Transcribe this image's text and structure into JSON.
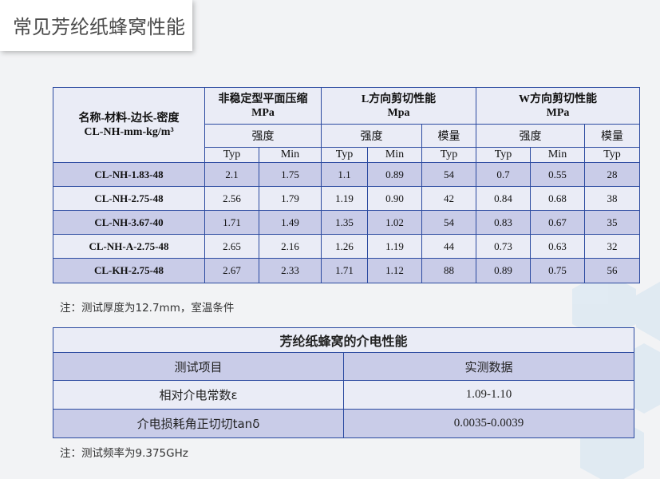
{
  "page_title": "常见芳纶纸蜂窝性能",
  "mech_table": {
    "name_header_line1": "名称-材料-边长-密度",
    "name_header_line2": "CL-NH-mm-kg/m³",
    "group1": {
      "line1": "非稳定型平面压缩",
      "line2": "MPa"
    },
    "group2": {
      "line1": "L方向剪切性能",
      "line2": "Mpa"
    },
    "group3": {
      "line1": "W方向剪切性能",
      "line2": "MPa"
    },
    "strength_label": "强度",
    "modulus_label": "模量",
    "typ_label": "Typ",
    "min_label": "Min",
    "rows": [
      {
        "name": "CL-NH-1.83-48",
        "values": [
          "2.1",
          "1.75",
          "1.1",
          "0.89",
          "54",
          "0.7",
          "0.55",
          "28"
        ]
      },
      {
        "name": "CL-NH-2.75-48",
        "values": [
          "2.56",
          "1.79",
          "1.19",
          "0.90",
          "42",
          "0.84",
          "0.68",
          "38"
        ]
      },
      {
        "name": "CL-NH-3.67-40",
        "values": [
          "1.71",
          "1.49",
          "1.35",
          "1.02",
          "54",
          "0.83",
          "0.67",
          "35"
        ]
      },
      {
        "name": "CL-NH-A-2.75-48",
        "values": [
          "2.65",
          "2.16",
          "1.26",
          "1.19",
          "44",
          "0.73",
          "0.63",
          "32"
        ]
      },
      {
        "name": "CL-KH-2.75-48",
        "values": [
          "2.67",
          "2.33",
          "1.71",
          "1.12",
          "88",
          "0.89",
          "0.75",
          "56"
        ]
      }
    ]
  },
  "note1": "注：测试厚度为12.7mm，室温条件",
  "dielectric_table": {
    "caption": "芳纶纸蜂窝的介电性能",
    "col1_header": "测试项目",
    "col2_header": "实测数据",
    "rows": [
      {
        "item": "相对介电常数ε",
        "value": "1.09-1.10"
      },
      {
        "item": "介电损耗角正切切tanδ",
        "value": "0.0035-0.0039"
      }
    ]
  },
  "note2": "注：测试频率为9.375GHz",
  "colors": {
    "border": "#2b4aa0",
    "header_light": "#eaecf6",
    "row_dark": "#c9cce8"
  }
}
